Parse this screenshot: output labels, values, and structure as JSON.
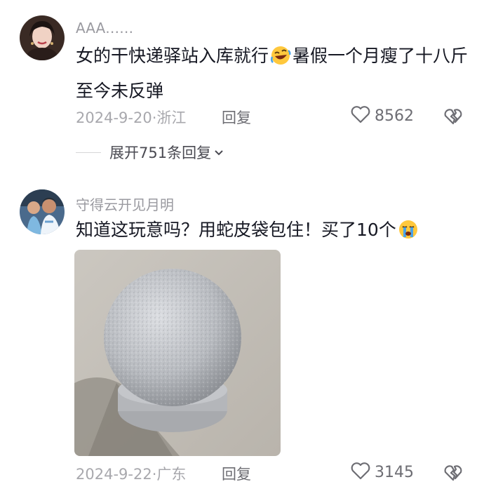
{
  "comments": [
    {
      "username": "AAA……",
      "text_part1": "女的干快递驿站入库就行",
      "text_part2": "暑假一个月瘦了十八斤 至今未反弹",
      "date": "2024-9-20",
      "location": "浙江",
      "reply_label": "回复",
      "likes": "8562",
      "expand_label": "展开751条回复",
      "emoji_icon": "rofl-emoji-icon"
    },
    {
      "username": "守得云开见月明",
      "text_part1": "知道这玩意吗？用蛇皮袋包住！买了10个",
      "date": "2024-9-22",
      "location": "广东",
      "reply_label": "回复",
      "likes": "3145",
      "emoji_icon": "crying-emoji-icon"
    }
  ],
  "colors": {
    "text": "#161823",
    "meta": "#a8a8ad",
    "secondary": "#6d6d73"
  }
}
